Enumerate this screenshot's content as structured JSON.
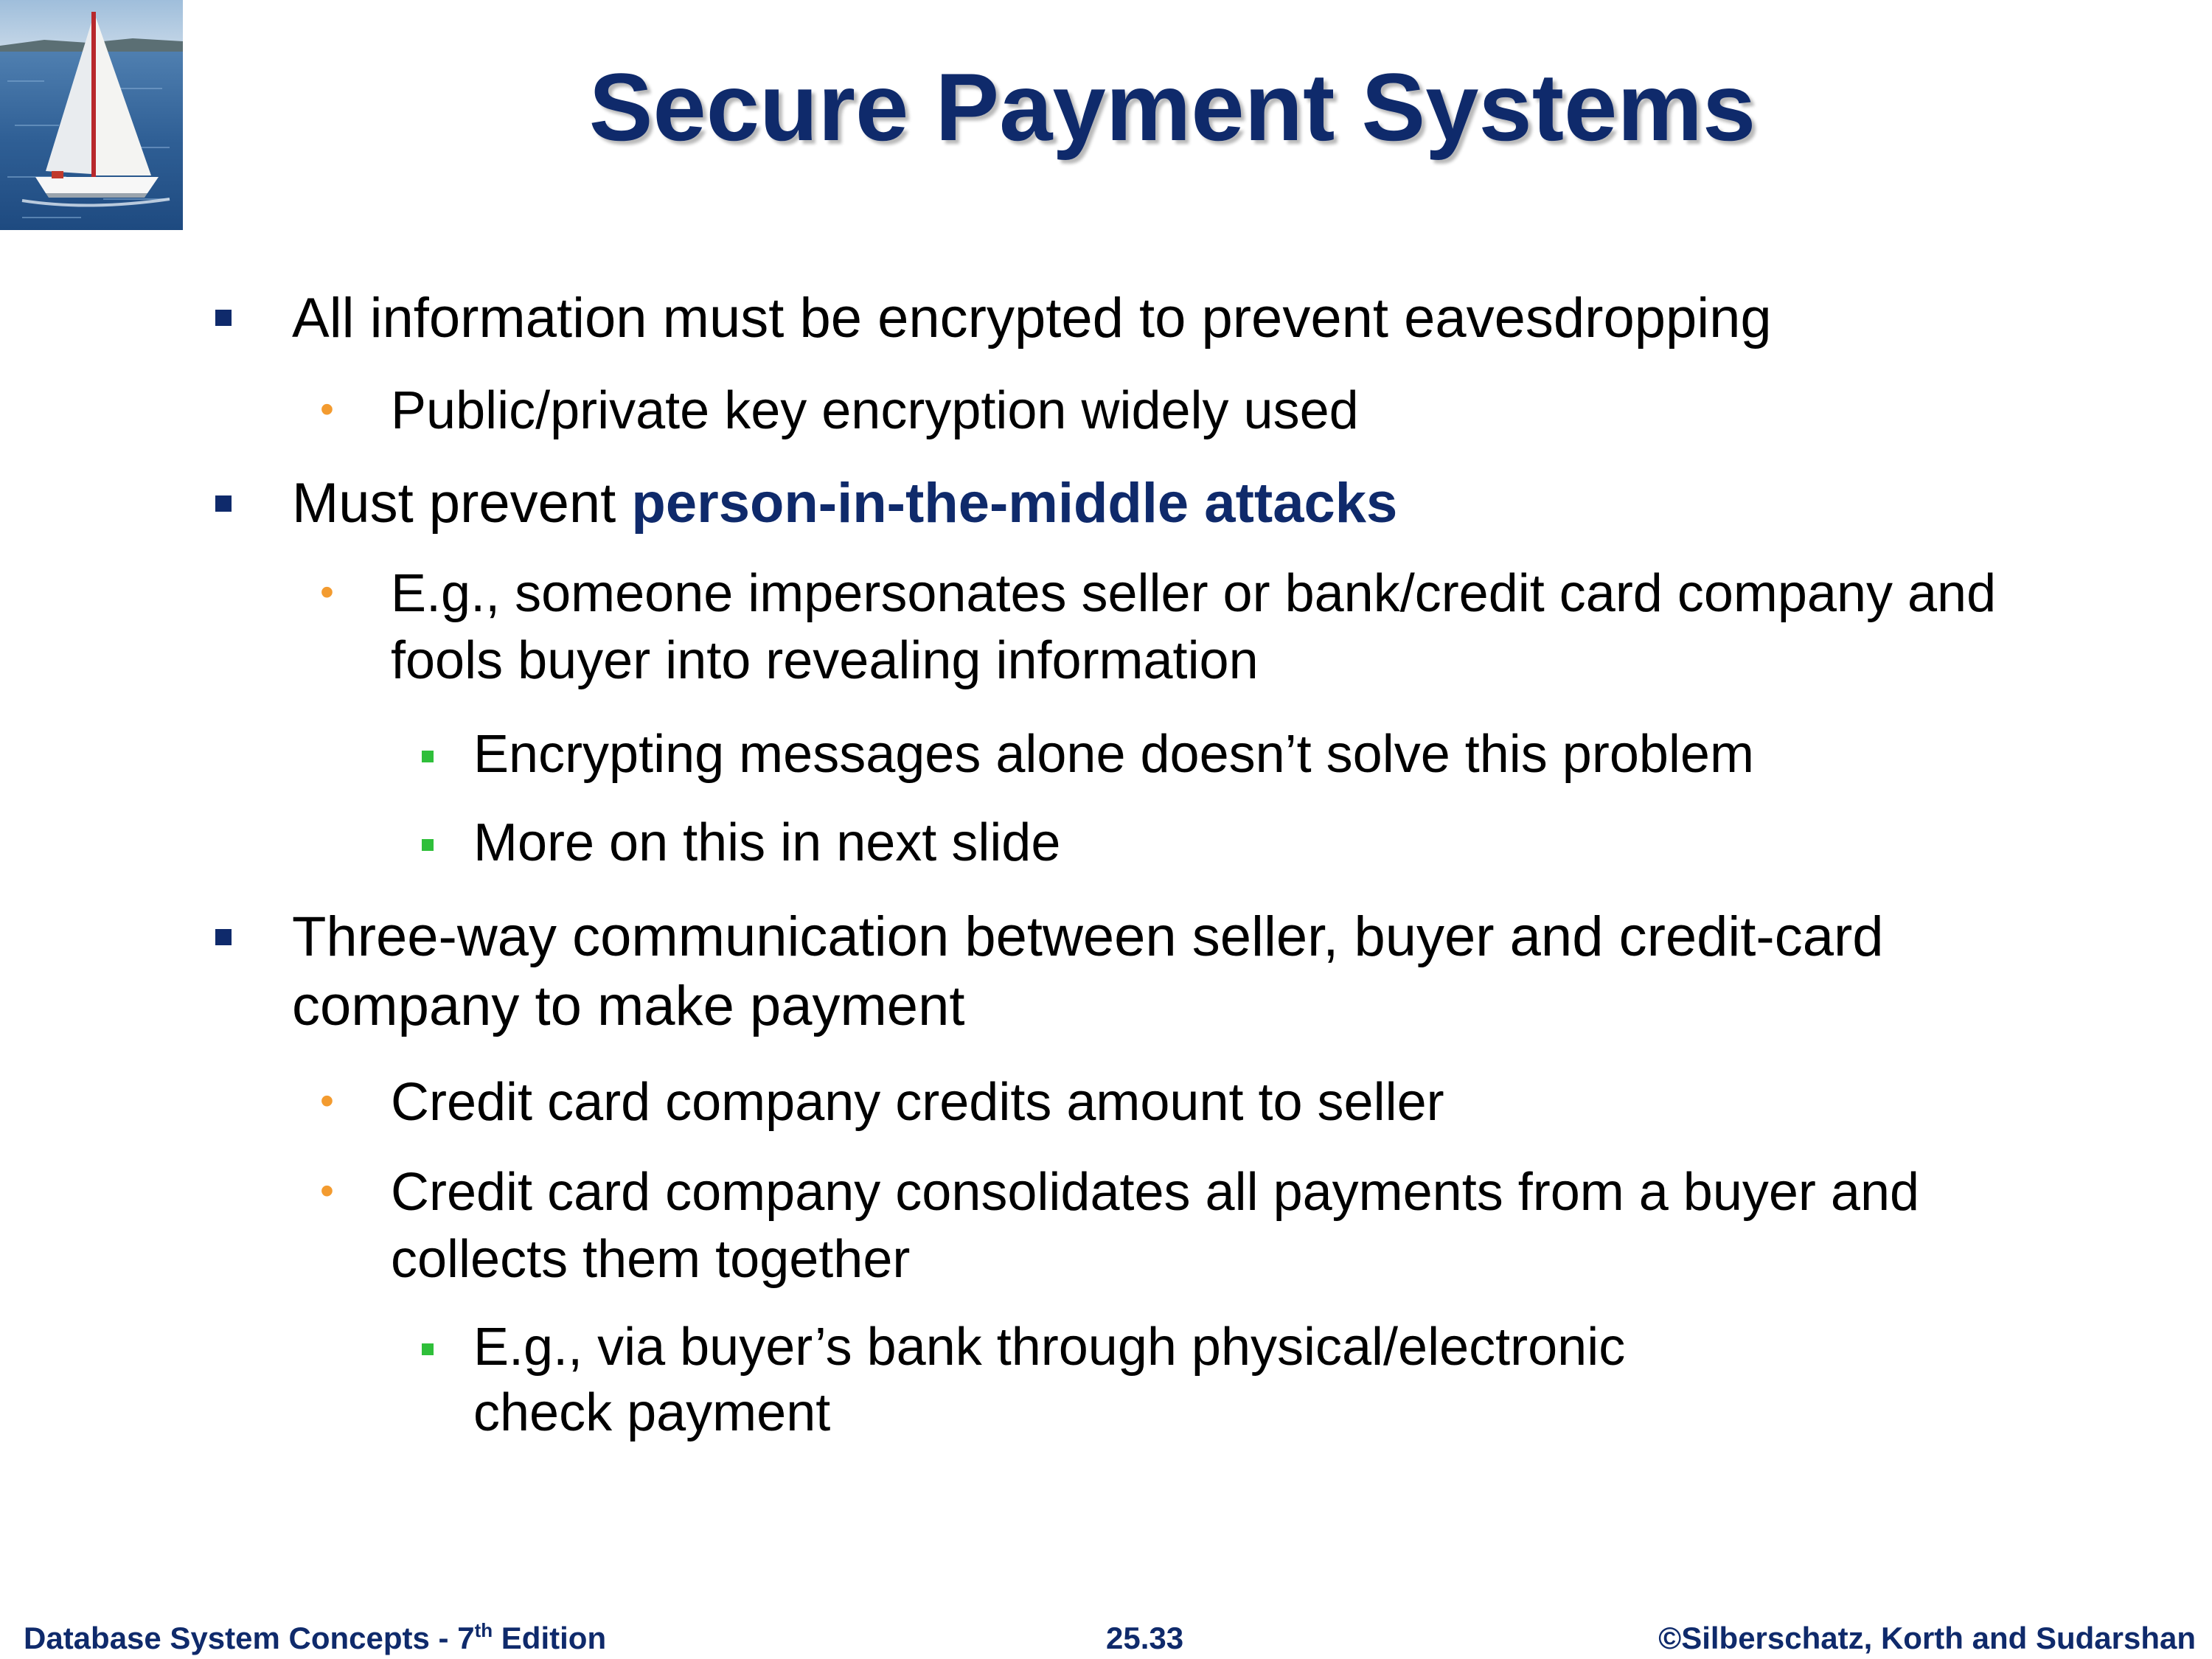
{
  "slide": {
    "title": "Secure Payment Systems",
    "bullets": {
      "b1": "All information must be encrypted to prevent eavesdropping",
      "b1_1": "Public/private key encryption widely used",
      "b2_prefix": "Must prevent ",
      "b2_highlight": "person-in-the-middle attacks",
      "b2_1_line1": "E.g., someone impersonates seller or bank/credit card company and",
      "b2_1_line2": "fools buyer into revealing information",
      "b2_1_1": "Encrypting messages alone doesn’t solve this problem",
      "b2_1_2": "More on this in next slide",
      "b3_line1": "Three-way communication between seller, buyer and credit-card",
      "b3_line2": "company to make payment",
      "b3_1": "Credit card company credits amount to seller",
      "b3_2_line1": "Credit card company consolidates all payments from a buyer and",
      "b3_2_line2": "collects them together",
      "b3_2_1_line1": "E.g., via buyer’s bank through physical/electronic",
      "b3_2_1_line2": "check payment"
    }
  },
  "footer": {
    "left_prefix": "Database System Concepts - 7",
    "left_sup": "th",
    "left_suffix": " Edition",
    "center": "25.33",
    "right": "©Silberschatz, Korth and Sudarshan"
  },
  "colors": {
    "title": "#0f2a6b",
    "highlight": "#0f2a6b",
    "level1_bullet": "#0f2a6b",
    "level2_bullet": "#f39b2f",
    "level3_bullet": "#2fbf3a",
    "footer": "#0f2a6b"
  },
  "icons": {
    "logo": "sailboat-photo-icon"
  }
}
